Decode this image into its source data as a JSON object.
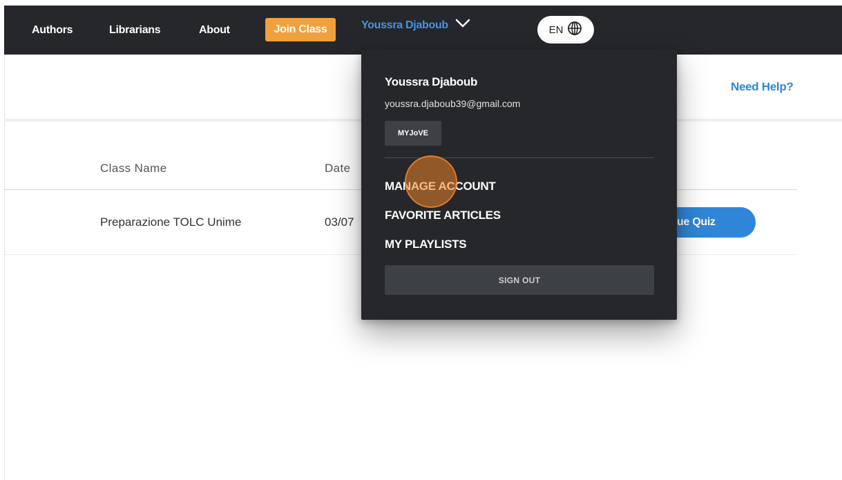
{
  "nav": {
    "authors": "Authors",
    "librarians": "Librarians",
    "about": "About",
    "join_class": "Join Class",
    "user_name": "Youssra Djaboub",
    "lang": "EN"
  },
  "subheader": {
    "need_help": "Need Help?"
  },
  "table": {
    "columns": [
      "Class Name",
      "Date"
    ],
    "rows": [
      {
        "class_name": "Preparazione TOLC Unime",
        "date": "03/07",
        "action": "ue Quiz"
      }
    ]
  },
  "dropdown": {
    "name": "Youssra Djaboub",
    "email": "youssra.djaboub39@gmail.com",
    "badge": "MYJoVE",
    "items": [
      "MANAGE ACCOUNT",
      "FAVORITE ARTICLES",
      "MY PLAYLISTS"
    ],
    "sign_out": "SIGN OUT"
  },
  "colors": {
    "nav_bg": "#25272a",
    "accent_orange": "#f0a13d",
    "link_blue": "#2f86d8",
    "user_blue": "#4a90e2"
  }
}
